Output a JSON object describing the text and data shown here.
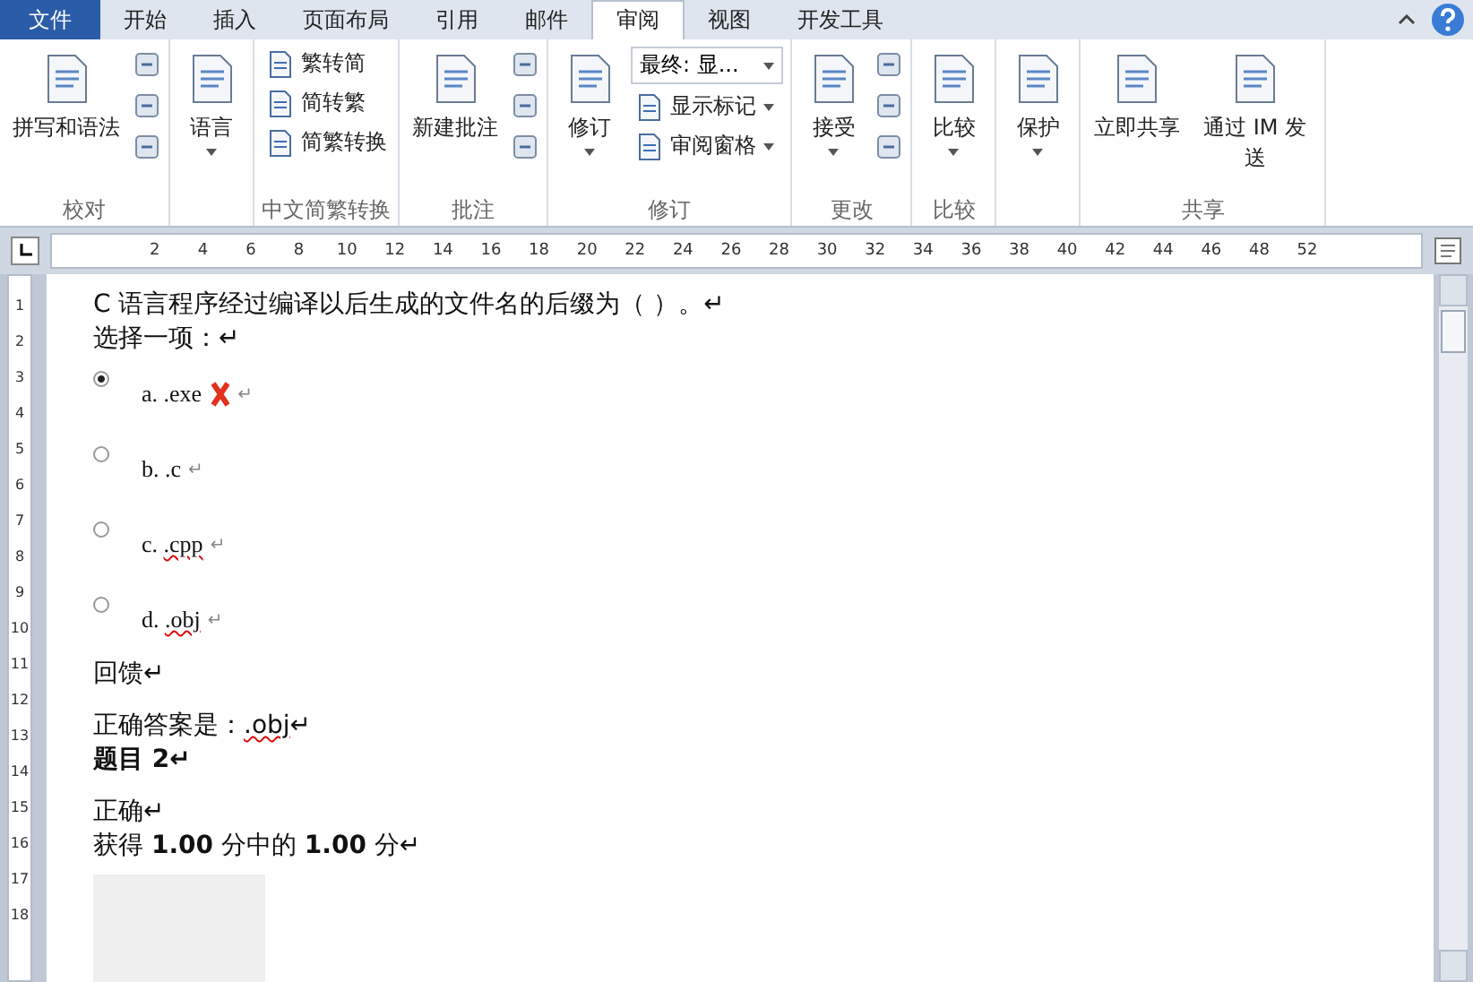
{
  "tabs": [
    {
      "label": "文件",
      "kind": "file",
      "selected": false
    },
    {
      "label": "开始",
      "kind": "tab",
      "selected": false
    },
    {
      "label": "插入",
      "kind": "tab",
      "selected": false
    },
    {
      "label": "页面布局",
      "kind": "tab",
      "selected": false
    },
    {
      "label": "引用",
      "kind": "tab",
      "selected": false
    },
    {
      "label": "邮件",
      "kind": "tab",
      "selected": false
    },
    {
      "label": "审阅",
      "kind": "tab",
      "selected": true
    },
    {
      "label": "视图",
      "kind": "tab",
      "selected": false
    },
    {
      "label": "开发工具",
      "kind": "tab",
      "selected": false
    }
  ],
  "ribbon": {
    "groups": [
      {
        "label": "校对",
        "columns": [
          [
            {
              "kind": "large",
              "label": "拼写和语法",
              "dropdown": false
            }
          ],
          [
            {
              "kind": "icon"
            },
            {
              "kind": "icon"
            },
            {
              "kind": "icon"
            }
          ]
        ]
      },
      {
        "columns": [
          [
            {
              "kind": "large",
              "label": "语言",
              "dropdown": true
            }
          ]
        ]
      },
      {
        "label": "中文简繁转换",
        "columns": [
          [
            {
              "kind": "small",
              "label": "繁转简",
              "dropdown": false
            },
            {
              "kind": "small",
              "label": "简转繁",
              "dropdown": false
            },
            {
              "kind": "small",
              "label": "简繁转换",
              "dropdown": false
            }
          ]
        ]
      },
      {
        "label": "批注",
        "columns": [
          [
            {
              "kind": "large",
              "label": "新建批注",
              "dropdown": false
            }
          ],
          [
            {
              "kind": "icon"
            },
            {
              "kind": "icon"
            },
            {
              "kind": "icon"
            }
          ]
        ]
      },
      {
        "label": "修订",
        "columns": [
          [
            {
              "kind": "large",
              "label": "修订",
              "dropdown": true
            }
          ],
          [
            {
              "kind": "select",
              "label": "最终: 显..."
            },
            {
              "kind": "small",
              "label": "显示标记",
              "dropdown": true
            },
            {
              "kind": "small",
              "label": "审阅窗格",
              "dropdown": true
            }
          ]
        ]
      },
      {
        "label": "更改",
        "columns": [
          [
            {
              "kind": "large",
              "label": "接受",
              "dropdown": true
            }
          ],
          [
            {
              "kind": "icon"
            },
            {
              "kind": "icon"
            },
            {
              "kind": "icon"
            }
          ]
        ]
      },
      {
        "label": "比较",
        "columns": [
          [
            {
              "kind": "large",
              "label": "比较",
              "dropdown": true
            }
          ]
        ]
      },
      {
        "columns": [
          [
            {
              "kind": "large",
              "label": "保护",
              "dropdown": true
            }
          ]
        ]
      },
      {
        "label": "共享",
        "columns": [
          [
            {
              "kind": "large",
              "label": "立即共享",
              "dropdown": false
            }
          ],
          [
            {
              "kind": "large",
              "label": "通过 IM 发送",
              "dropdown": false
            }
          ]
        ]
      }
    ]
  },
  "ruler": {
    "ticks": [
      "2",
      "4",
      "6",
      "8",
      "10",
      "12",
      "14",
      "16",
      "18",
      "20",
      "22",
      "24",
      "26",
      "28",
      "30",
      "32",
      "34",
      "36",
      "38",
      "40",
      "42",
      "44",
      "46",
      "48",
      "52"
    ]
  },
  "vertical_ruler": {
    "ticks": [
      "1",
      "2",
      "3",
      "4",
      "5",
      "6",
      "7",
      "8",
      "9",
      "10",
      "11",
      "12",
      "13",
      "14",
      "15",
      "16",
      "17",
      "18"
    ]
  },
  "document": {
    "question": "C 语言程序经过编译以后生成的文件名的后缀为（  ）。↵",
    "prompt": "选择一项：↵",
    "options": [
      {
        "letter": "a.",
        "text": ".exe",
        "end": "↵",
        "selected": true,
        "wrong": true,
        "misspelled": false
      },
      {
        "letter": "b.",
        "text": ".c",
        "end": "↵",
        "selected": false,
        "wrong": false,
        "misspelled": false
      },
      {
        "letter": "c.",
        "text": ".cpp",
        "end": "↵",
        "selected": false,
        "wrong": false,
        "misspelled": true
      },
      {
        "letter": "d.",
        "text": ".obj",
        "end": "↵",
        "selected": false,
        "wrong": false,
        "misspelled": true
      }
    ],
    "feedback": "回馈↵",
    "answer_label": "正确答案是：",
    "answer_value": ".obj",
    "answer_end": "↵",
    "heading": "题目 2↵",
    "result": "正确↵",
    "score": "获得 **1.00** 分中的 **1.00** 分↵"
  }
}
